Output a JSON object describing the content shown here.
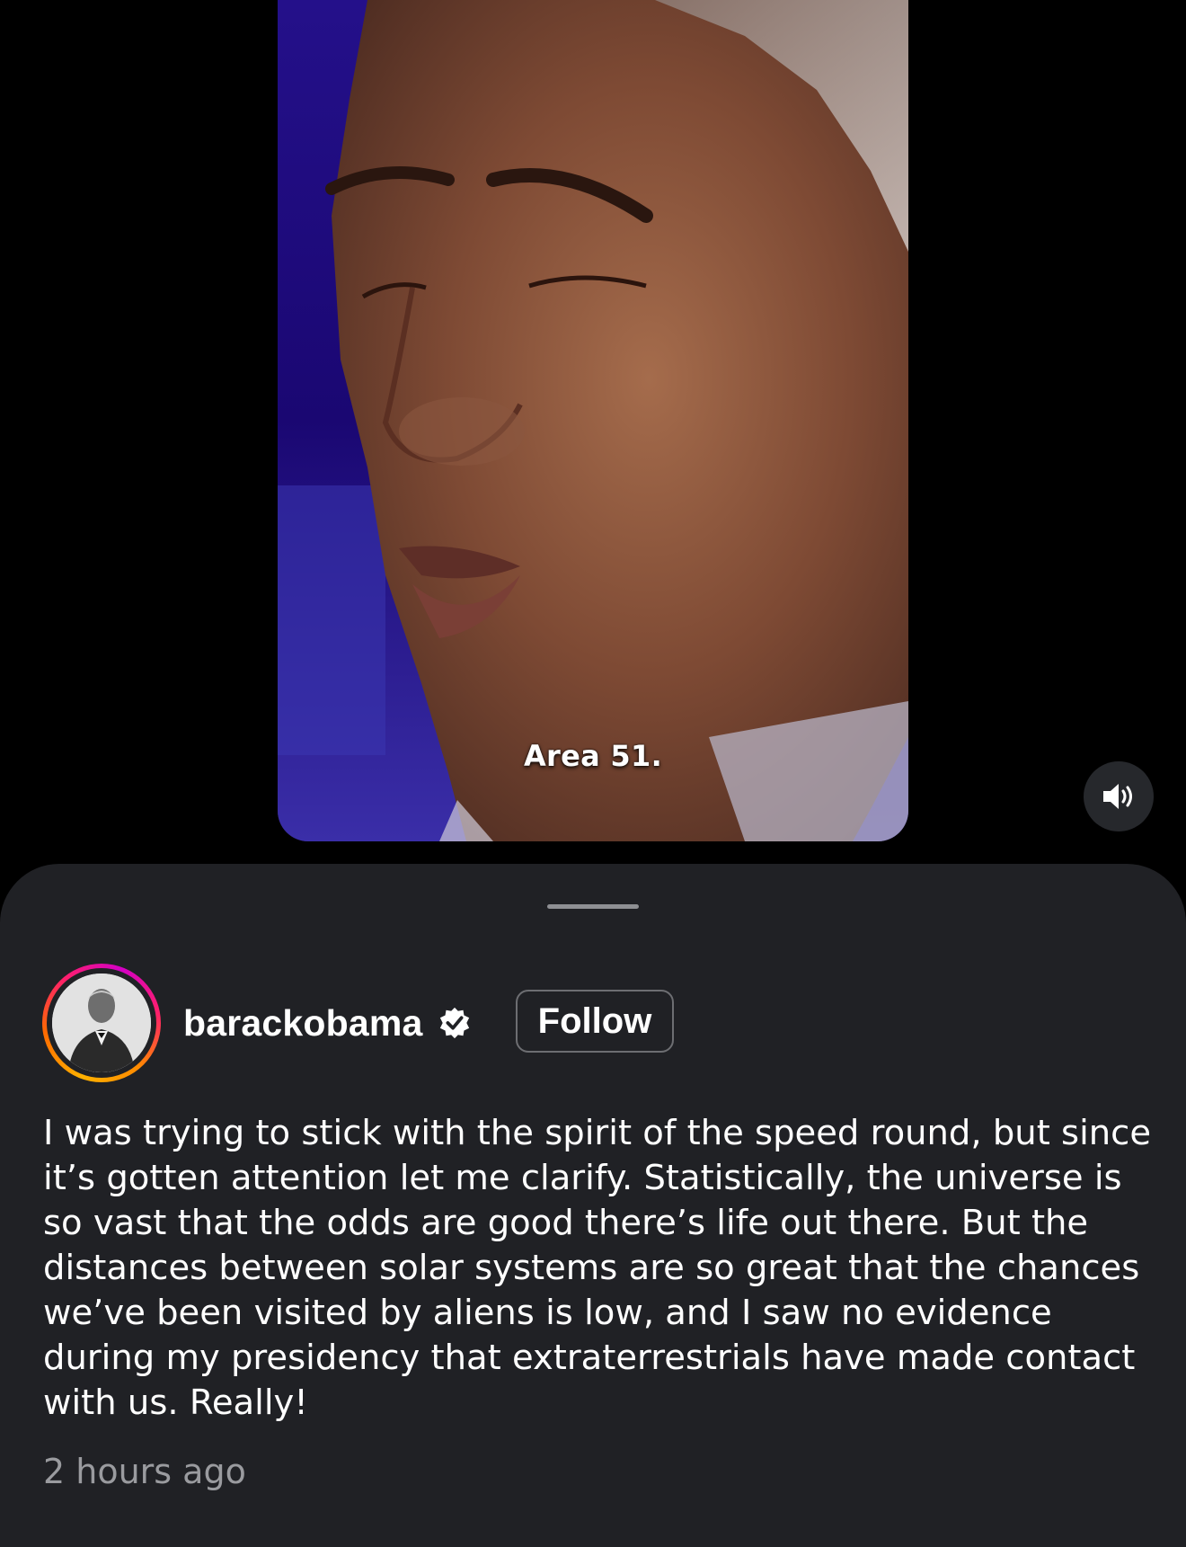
{
  "video": {
    "caption": "Area 51.",
    "sound_icon": "speaker-on-icon"
  },
  "post": {
    "username": "barackobama",
    "verified_icon": "verified-badge-icon",
    "follow_label": "Follow",
    "text": "I was trying to stick with the spirit of the speed round, but since it’s gotten attention let me clarify. Statistically, the universe is so vast that the odds are good there’s life out there. But the distances between solar systems are so great that the chances we’ve been visited by aliens is low, and I saw no evidence during my presidency that extraterrestrials have made contact with us. Really!",
    "timestamp": "2 hours ago"
  },
  "colors": {
    "background": "#000000",
    "sheet": "#202125",
    "secondary_text": "#9a9b9f",
    "video_backdrop": "#2a0a8a"
  }
}
